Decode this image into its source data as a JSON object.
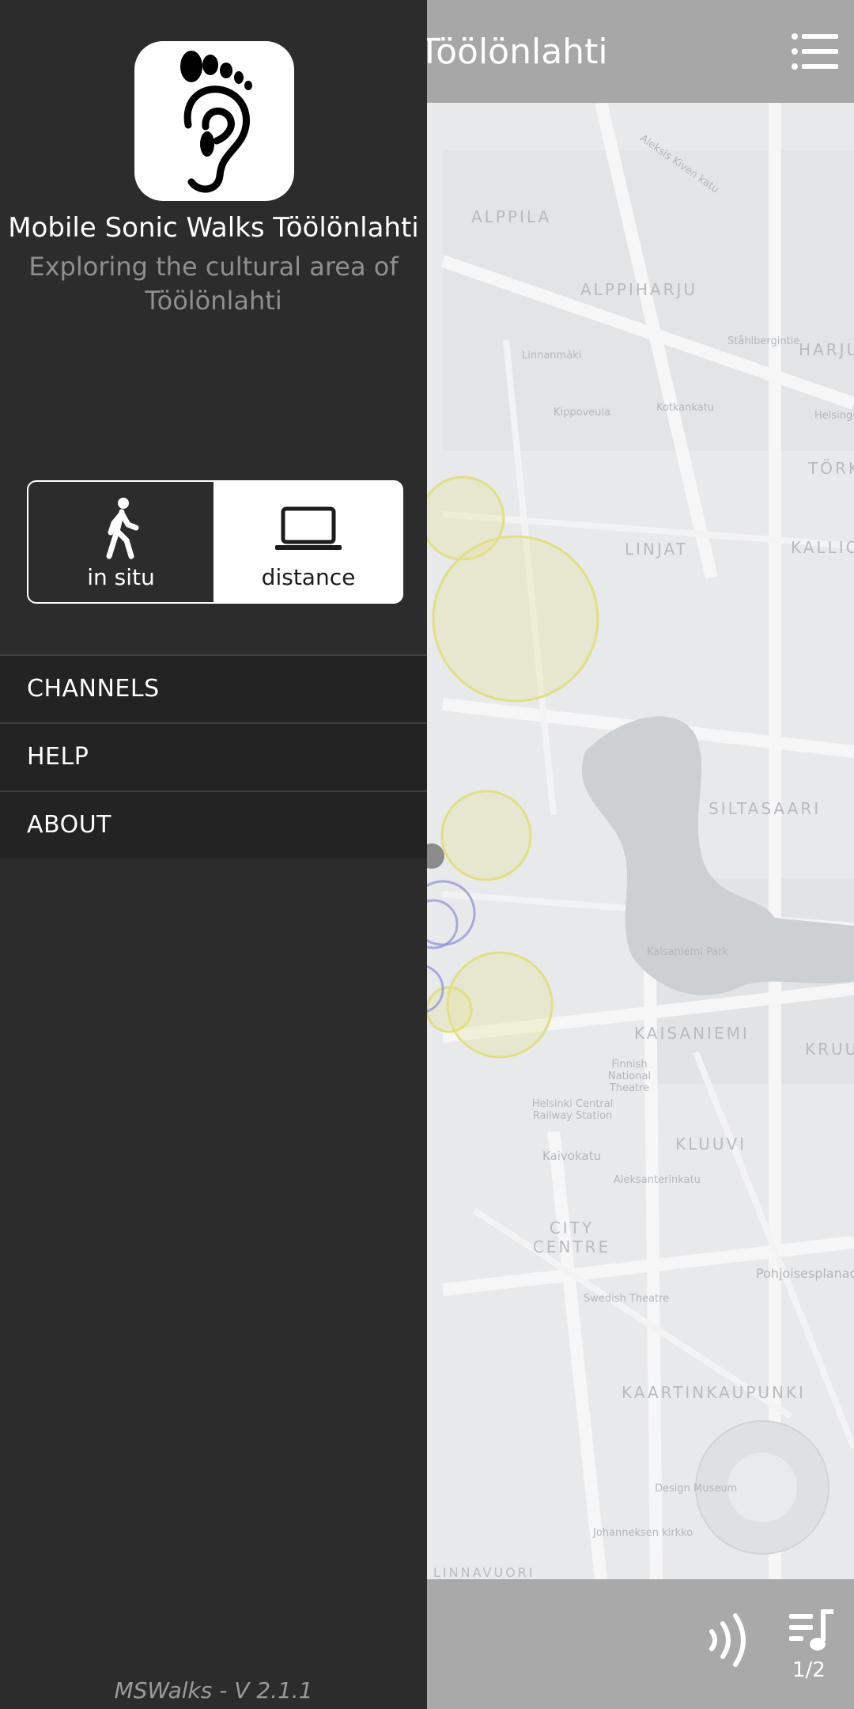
{
  "app_header": {
    "title": "Töölönlahti"
  },
  "map": {
    "districts": [
      "ALPPILA",
      "ALPPIHARJU",
      "HARJU",
      "TÖRK",
      "LINJAT",
      "KALLIO",
      "SILTASAARI",
      "KAISANIEMI",
      "KRUU",
      "KLUUVI",
      "CITY CENTRE",
      "KAARTINKAUPUNKI",
      "LINNAVUORI"
    ],
    "streets": [
      "Aleksis Kiven katu",
      "Linnanmäki",
      "Kippoveula",
      "Kotkankatu",
      "Alppila",
      "Ståhlbergintie",
      "Helsinginkatu",
      "Kaisaniemi Park",
      "Finnish National Theatre",
      "Helsinki Central Railway Station",
      "Kaivokatu",
      "Aleksanterinkatu",
      "Pohjoisesplanadi",
      "Swedish Theatre",
      "Design Museum",
      "Johanneksen kirkko"
    ]
  },
  "drawer": {
    "app_name": "Mobile Sonic Walks Töölönlahti",
    "subtitle": "Exploring the cultural area of Töölönlahti",
    "modes": {
      "in_situ": "in situ",
      "distance": "distance"
    },
    "nav": [
      "CHANNELS",
      "HELP",
      "ABOUT"
    ],
    "version": "MSWalks - V 2.1.1"
  },
  "player": {
    "playlist_count": "1/2"
  },
  "colors": {
    "drawer_bg": "#2c2c2c",
    "nav_bg": "#232323",
    "header_bg": "#a7a7a7",
    "map_bg": "#e8e9eb",
    "zone_yellow": "#e6e39a",
    "zone_blue": "#8a8fd6"
  }
}
